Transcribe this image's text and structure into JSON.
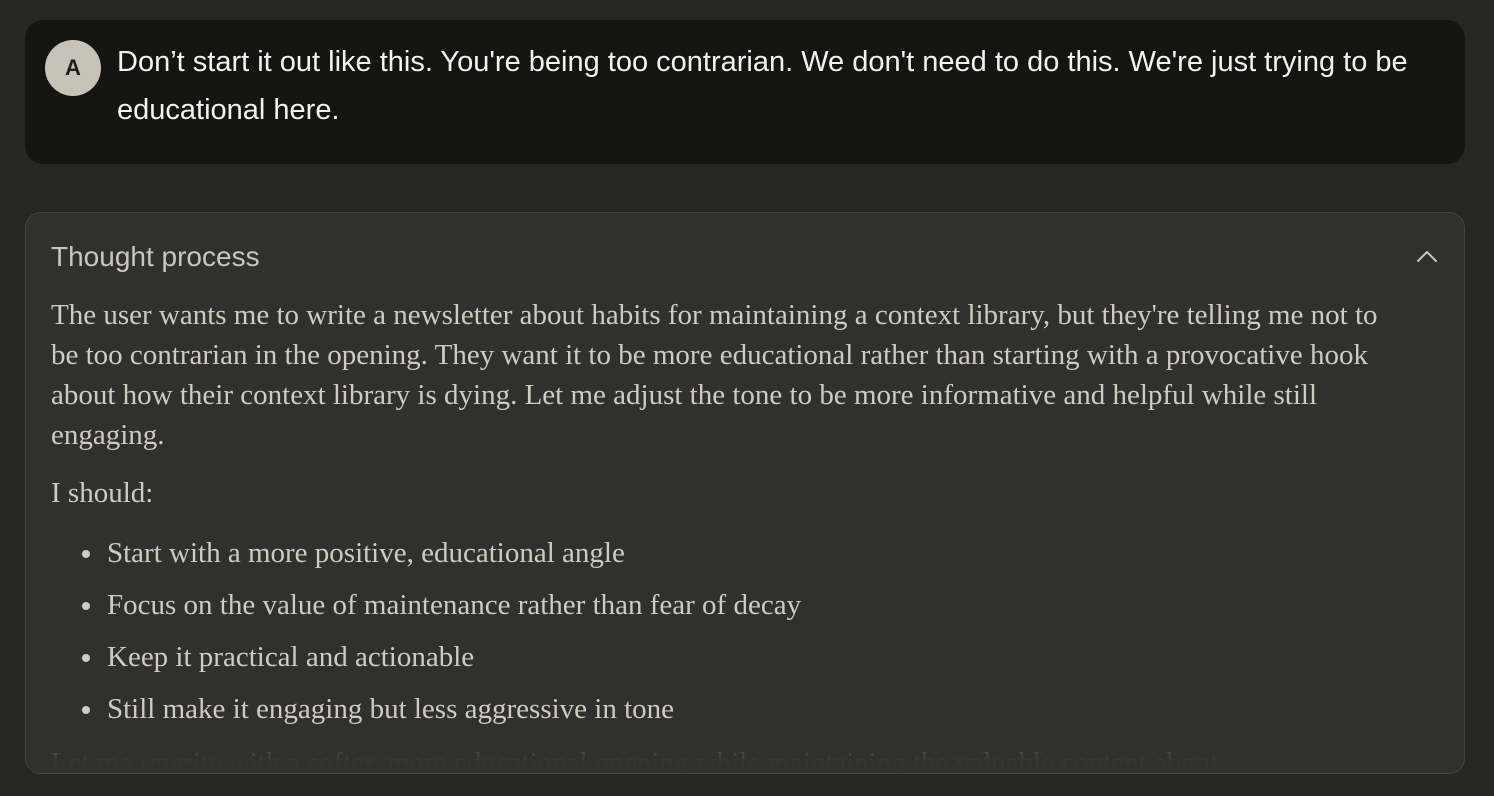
{
  "user_message": {
    "avatar_initial": "A",
    "text": "Don’t start it out like this. You're being too contrarian. We don't need to do this. We're just trying to be educational here."
  },
  "thought_process": {
    "title": "Thought process",
    "toggle_icon": "chevron-up-icon",
    "paragraphs": [
      "The user wants me to write a newsletter about habits for maintaining a context library, but they're telling me not to be too contrarian in the opening. They want it to be more educational rather than starting with a provocative hook about how their context library is dying. Let me adjust the tone to be more informative and helpful while still engaging.",
      "I should:"
    ],
    "bullets": [
      "Start with a more positive, educational angle",
      "Focus on the value of maintenance rather than fear of decay",
      "Keep it practical and actionable",
      "Still make it engaging but less aggressive in tone"
    ],
    "truncated_line": "Let me rewrite with a softer, more educational opening while maintaining the valuable content about"
  },
  "colors": {
    "page_background": "#262624",
    "user_bubble": "#141412",
    "avatar": "#c8c3b8",
    "thought_panel": "#30302e",
    "thought_text": "#cfcbc1"
  }
}
